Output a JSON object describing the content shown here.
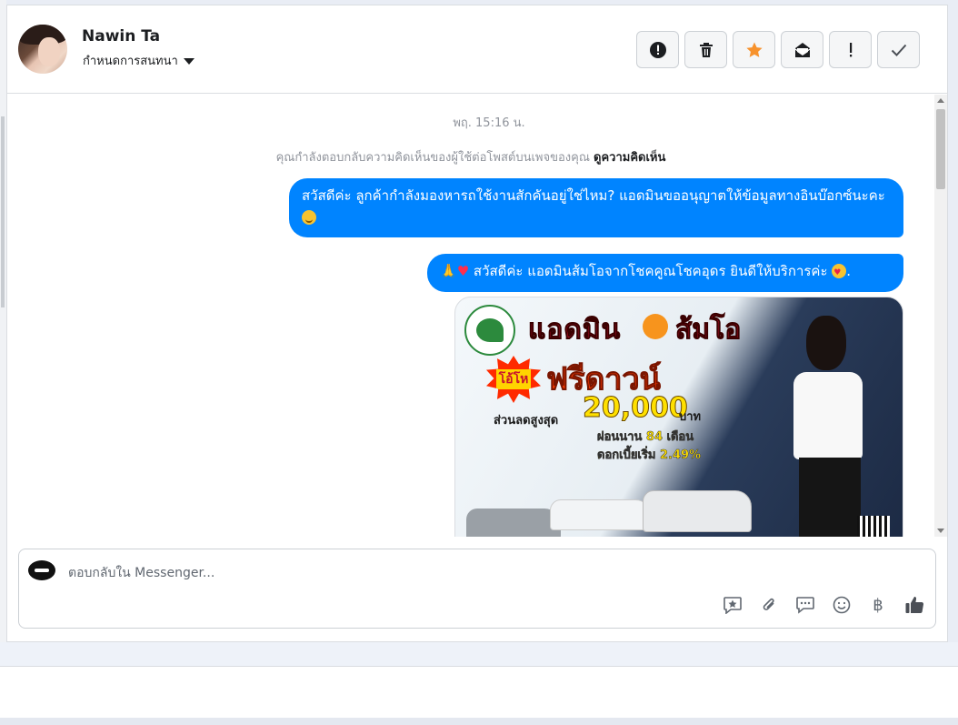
{
  "header": {
    "contact_name": "Nawin Ta",
    "assign_label": "กำหนดการสนทนา",
    "toolbar": [
      {
        "name": "report-spam-button",
        "icon": "alert-circle-icon"
      },
      {
        "name": "delete-button",
        "icon": "trash-icon"
      },
      {
        "name": "star-button",
        "icon": "star-icon"
      },
      {
        "name": "mark-unread-button",
        "icon": "envelope-open-icon"
      },
      {
        "name": "mark-important-button",
        "icon": "exclamation-icon"
      },
      {
        "name": "mark-done-button",
        "icon": "check-icon"
      }
    ],
    "accent_star_color": "#f7922d"
  },
  "chat": {
    "timestamp": "พฤ. 15:16 น.",
    "notice_text": "คุณกำลังตอบกลับความคิดเห็นของผู้ใช้ต่อโพสต์บนเพจของคุณ",
    "notice_link": "ดูความคิดเห็น",
    "messages": [
      {
        "text": "สวัสดีค่ะ ลูกค้ากำลังมองหารถใช้งานสักคันอยู่ใช่ไหม? แอดมินขออนุญาตให้ข้อมูลทางอินบ๊อกซ์นะคะ",
        "emoji": "smile-emoji"
      },
      {
        "text": "สวัสดีค่ะ แอดมินส้มโอจากโชคคูณโชคอุดร ยินดีให้บริการค่ะ",
        "emoji_leading": "pray-heart-emoji",
        "trailing": "."
      }
    ],
    "bubble_color": "#0084ff",
    "promo_image": {
      "title_part1": "แอดมิน",
      "title_part2": "ส้มโอ",
      "burst_text": "โอ้โห",
      "headline": "ฟรีดาวน์",
      "discount_label": "ส่วนลดสูงสุด",
      "discount_value": "20,000",
      "discount_unit": "บาท",
      "installment": "ผ่อนนาน 84 เดือน",
      "interest": "ดอกเบี้ยเริ่ม 2.49%"
    }
  },
  "composer": {
    "placeholder": "ตอบกลับใน Messenger...",
    "actions": [
      {
        "name": "saved-reply-button",
        "icon": "saved-reply-icon"
      },
      {
        "name": "attach-button",
        "icon": "paperclip-icon"
      },
      {
        "name": "quick-reply-button",
        "icon": "chat-bubble-icon"
      },
      {
        "name": "emoji-button",
        "icon": "smiley-icon"
      },
      {
        "name": "payment-button",
        "icon": "baht-icon",
        "glyph": "฿"
      },
      {
        "name": "like-button",
        "icon": "thumbs-up-icon"
      }
    ]
  }
}
